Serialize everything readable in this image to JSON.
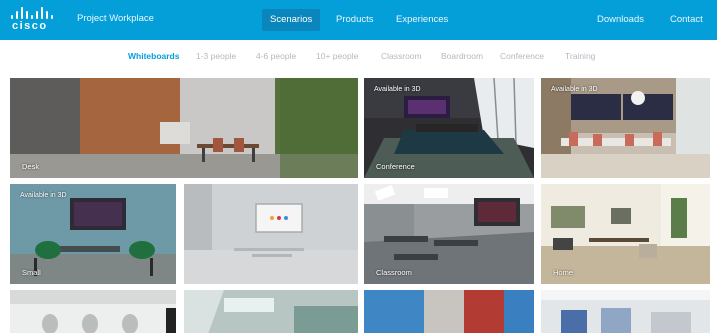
{
  "header": {
    "logo_text": "cisco",
    "app_title": "Project Workplace",
    "nav": {
      "scenarios": "Scenarios",
      "products": "Products",
      "experiences": "Experiences",
      "downloads": "Downloads",
      "contact": "Contact"
    },
    "active_nav": "Scenarios",
    "brand_color": "#049fd9"
  },
  "filters": {
    "items": [
      "Whiteboards",
      "1-3 people",
      "4-6 people",
      "10+ people",
      "Classroom",
      "Boardroom",
      "Conference",
      "Training"
    ],
    "active": "Whiteboards",
    "accent_color": "#049fd9"
  },
  "tiles": {
    "t0": {
      "badge": "",
      "caption": "Desk"
    },
    "t1": {
      "badge": "Available in 3D",
      "caption": "Conference"
    },
    "t2": {
      "badge": "Available in 3D",
      "caption": ""
    },
    "t3": {
      "badge": "Available in 3D",
      "caption": "Small"
    },
    "t4": {
      "badge": "",
      "caption": ""
    },
    "t5": {
      "badge": "",
      "caption": "Classroom"
    },
    "t6": {
      "badge": "",
      "caption": "Home"
    },
    "t7": {
      "badge": "",
      "caption": ""
    },
    "t8": {
      "badge": "",
      "caption": ""
    },
    "t9": {
      "badge": "",
      "caption": ""
    }
  }
}
